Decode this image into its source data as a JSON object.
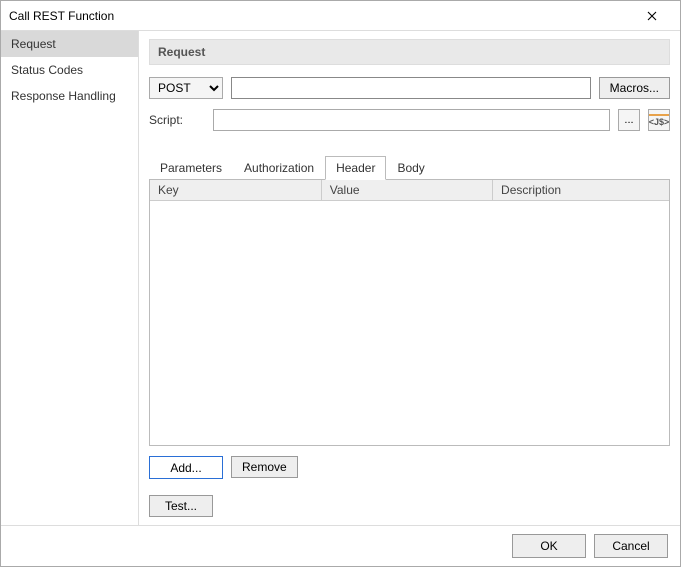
{
  "dialog": {
    "title": "Call REST Function"
  },
  "sidebar": {
    "items": [
      {
        "label": "Request",
        "selected": true
      },
      {
        "label": "Status Codes",
        "selected": false
      },
      {
        "label": "Response Handling",
        "selected": false
      }
    ]
  },
  "section": {
    "heading": "Request"
  },
  "form": {
    "method": "POST",
    "url": "",
    "macros_button": "Macros...",
    "script_label": "Script:",
    "script_value": "",
    "browse_button": "...",
    "js_button": "<J$>"
  },
  "tabs": [
    {
      "label": "Parameters",
      "active": false
    },
    {
      "label": "Authorization",
      "active": false
    },
    {
      "label": "Header",
      "active": true
    },
    {
      "label": "Body",
      "active": false
    }
  ],
  "table": {
    "columns": [
      "Key",
      "Value",
      "Description"
    ],
    "rows": []
  },
  "buttons": {
    "add": "Add...",
    "remove": "Remove",
    "test": "Test...",
    "ok": "OK",
    "cancel": "Cancel"
  }
}
